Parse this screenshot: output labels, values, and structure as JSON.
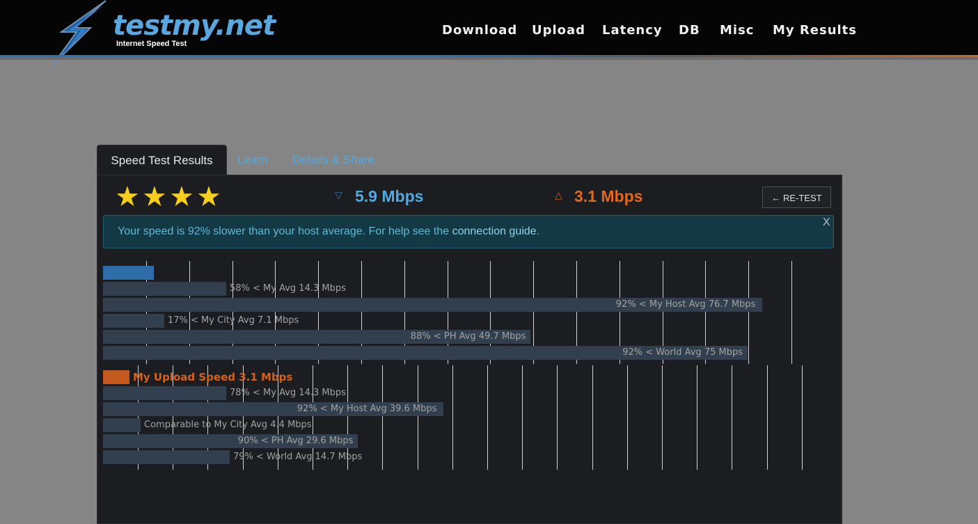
{
  "site": {
    "logo_text": "testmy.net",
    "tagline": "Internet Speed Test"
  },
  "nav": [
    {
      "label": "Download"
    },
    {
      "label": "Upload"
    },
    {
      "label": "Latency"
    },
    {
      "label": "DB"
    },
    {
      "label": "Misc"
    },
    {
      "label": "My Results"
    }
  ],
  "tabs": [
    {
      "label": "Speed Test Results",
      "active": true
    },
    {
      "label": "Learn",
      "active": false
    },
    {
      "label": "Details & Share",
      "active": false
    }
  ],
  "rating": {
    "stars": 4,
    "max": 4,
    "icon": "star-icon"
  },
  "summary": {
    "download_speed": "5.9 Mbps",
    "upload_speed": "3.1 Mbps",
    "download_icon": "download-arrow-icon",
    "upload_icon": "upload-arrow-icon",
    "retest_label": "← RE-TEST"
  },
  "alert": {
    "text": "Your speed is 92% slower than your host average. For help see the ",
    "link": "connection guide",
    "suffix": ".",
    "close": "X"
  },
  "colors": {
    "download": "#2f6da8",
    "upload": "#c55a21",
    "comparison_bar": "#313f4e",
    "download_text": "#53a8e0",
    "upload_text": "#e1681f",
    "star": "#f7ce1f"
  },
  "chart_data": {
    "type": "bar",
    "orientation": "horizontal",
    "unit": "Mbps",
    "download": {
      "value": 5.9,
      "label": "",
      "comparisons": [
        {
          "label": "58% < My Avg 14.3 Mbps",
          "value": 14.3
        },
        {
          "label": "92% < My Host Avg 76.7 Mbps",
          "value": 76.7
        },
        {
          "label": "17% < My City Avg 7.1 Mbps",
          "value": 7.1
        },
        {
          "label": "88% < PH Avg 49.7 Mbps",
          "value": 49.7
        },
        {
          "label": "92% < World Avg 75 Mbps",
          "value": 75
        }
      ]
    },
    "upload": {
      "value": 3.1,
      "label": "My Upload Speed 3.1 Mbps",
      "comparisons": [
        {
          "label": "78% < My Avg 14.3 Mbps",
          "value": 14.3
        },
        {
          "label": "92% < My Host Avg 39.6 Mbps",
          "value": 39.6
        },
        {
          "label": "Comparable to My City Avg 4.4 Mbps",
          "value": 4.4
        },
        {
          "label": "90% < PH Avg 29.6 Mbps",
          "value": 29.6
        },
        {
          "label": "79% < World Avg 14.7 Mbps",
          "value": 14.7
        }
      ]
    }
  }
}
